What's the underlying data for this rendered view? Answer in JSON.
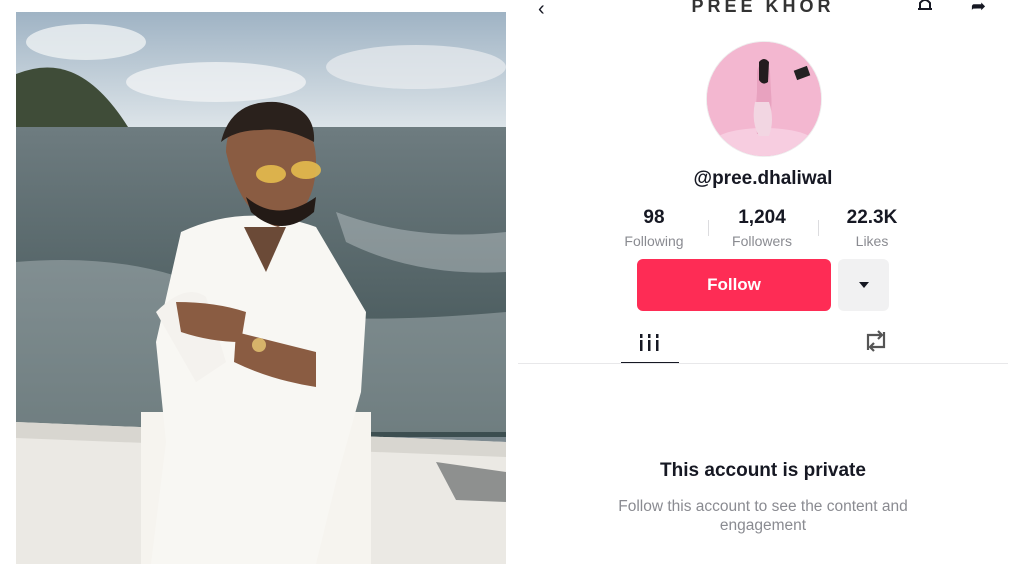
{
  "photo": {
    "description_icon": "man-on-boat-photo"
  },
  "profile": {
    "topbar_title": "PREE KHOR",
    "handle": "@pree.dhaliwal",
    "stats": [
      {
        "value": "98",
        "label": "Following"
      },
      {
        "value": "1,204",
        "label": "Followers"
      },
      {
        "value": "22.3K",
        "label": "Likes"
      }
    ],
    "follow_label": "Follow",
    "private_title": "This account is private",
    "private_desc": "Follow this account to see the content and engagement"
  },
  "colors": {
    "accent": "#fe2c55",
    "secondary_btn": "#f1f1f2",
    "muted_text": "#8a8b91"
  },
  "icons": [
    "back-arrow-icon",
    "bell-icon",
    "share-icon",
    "dropdown-caret-icon",
    "grid-tab-icon",
    "repost-icon"
  ]
}
